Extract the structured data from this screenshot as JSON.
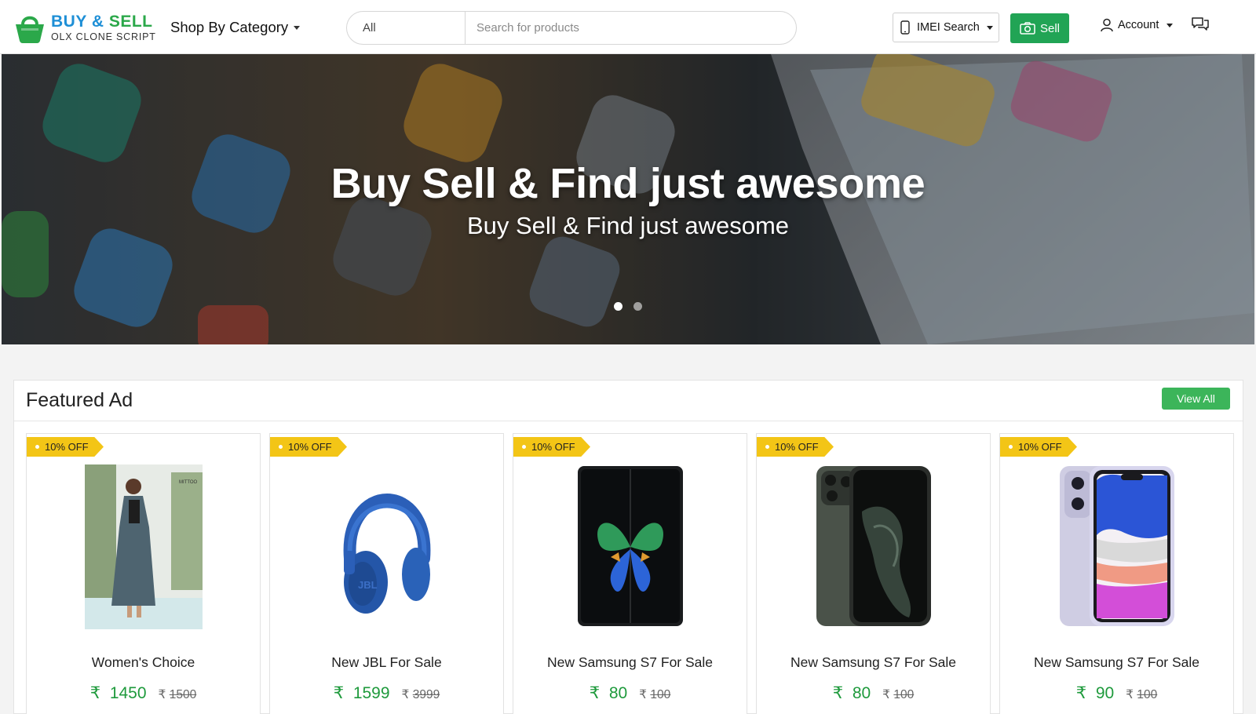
{
  "header": {
    "logo_title_1": "BUY",
    "logo_title_amp": "&",
    "logo_title_2": "SELL",
    "logo_subtitle": "OLX CLONE SCRIPT",
    "shop_by_category": "Shop By Category",
    "search_category": "All",
    "search_placeholder": "Search for products",
    "imei_label": "IMEI Search",
    "sell_label": "Sell",
    "account_label": "Account"
  },
  "hero": {
    "title": "Buy Sell & Find just awesome",
    "subtitle": "Buy Sell & Find just awesome",
    "slides": 2,
    "active_slide": 1
  },
  "featured": {
    "title": "Featured Ad",
    "view_all": "View All",
    "currency": "₹",
    "items": [
      {
        "badge": "10% OFF",
        "title": "Women's Choice",
        "price": "1450",
        "old_price": "1500"
      },
      {
        "badge": "10% OFF",
        "title": "New JBL For Sale",
        "price": "1599",
        "old_price": "3999"
      },
      {
        "badge": "10% OFF",
        "title": "New Samsung S7 For Sale",
        "price": "80",
        "old_price": "100"
      },
      {
        "badge": "10% OFF",
        "title": "New Samsung S7 For Sale",
        "price": "80",
        "old_price": "100"
      },
      {
        "badge": "10% OFF",
        "title": "New Samsung S7 For Sale",
        "price": "90",
        "old_price": "100"
      }
    ]
  },
  "colors": {
    "brand_blue": "#1e8fd6",
    "brand_green": "#2ba84a",
    "sell_green": "#21a455",
    "badge_yellow": "#f3c516",
    "price_green": "#1e9a3c"
  }
}
